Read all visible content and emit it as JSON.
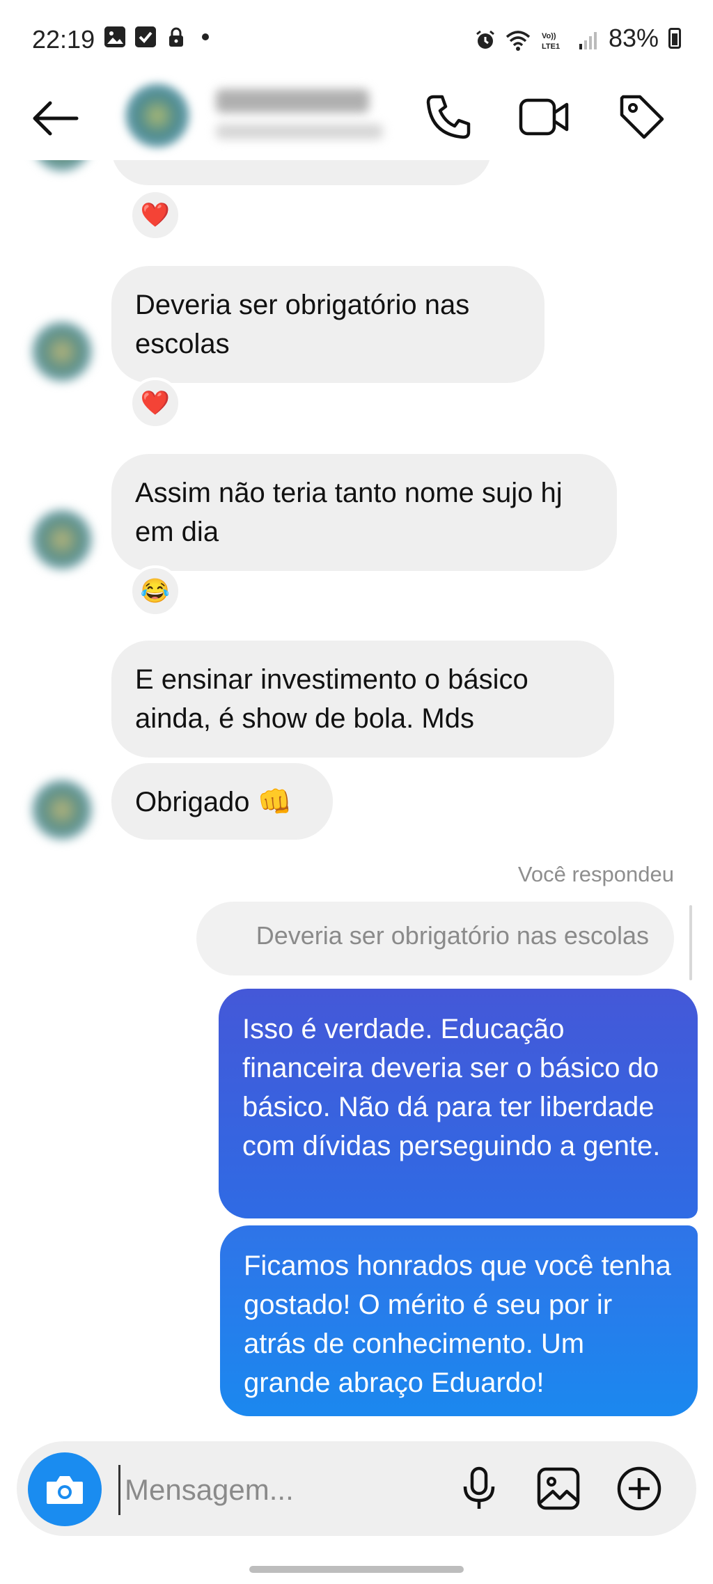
{
  "status_bar": {
    "time": "22:19",
    "battery": "83%",
    "left_icons": [
      "image-icon",
      "checkbox-icon",
      "lock-icon",
      "dot-icon"
    ],
    "right_icons": [
      "alarm-icon",
      "wifi-icon",
      "volte-icon",
      "signal-icon",
      "battery-icon"
    ]
  },
  "header": {
    "back_icon": "arrow-left-icon",
    "contact_name": "",
    "contact_status": "",
    "actions": [
      "phone-icon",
      "video-camera-icon",
      "tag-icon"
    ]
  },
  "messages": {
    "m0_reaction": "❤️",
    "m1_text": "Deveria ser obrigatório nas escolas",
    "m1_reaction": "❤️",
    "m2_text": "Assim não teria tanto nome sujo hj em dia",
    "m2_reaction": "😂",
    "m3_text": "E ensinar investimento o básico ainda, é show de bola. Mds",
    "m4_text": "Obrigado 👊",
    "replied_label": "Você respondeu",
    "reply_quote": "Deveria ser obrigatório nas escolas",
    "out1_text": "Isso é verdade. Educação financeira deveria ser o básico do básico. Não dá para ter liberdade com dívidas perseguindo a gente.",
    "out2_text": "Ficamos honrados que você tenha gostado! O mérito é seu por ir atrás de conhecimento. Um grande abraço Eduardo!"
  },
  "composer": {
    "placeholder": "Mensagem...",
    "value": "",
    "icons": [
      "camera-icon",
      "microphone-icon",
      "gallery-icon",
      "plus-circle-icon"
    ]
  },
  "colors": {
    "incoming_bubble": "#efefef",
    "outgoing_gradient_top": "#4458d8",
    "outgoing_gradient_bottom": "#1b88ef",
    "camera_button": "#1a8cf0"
  }
}
